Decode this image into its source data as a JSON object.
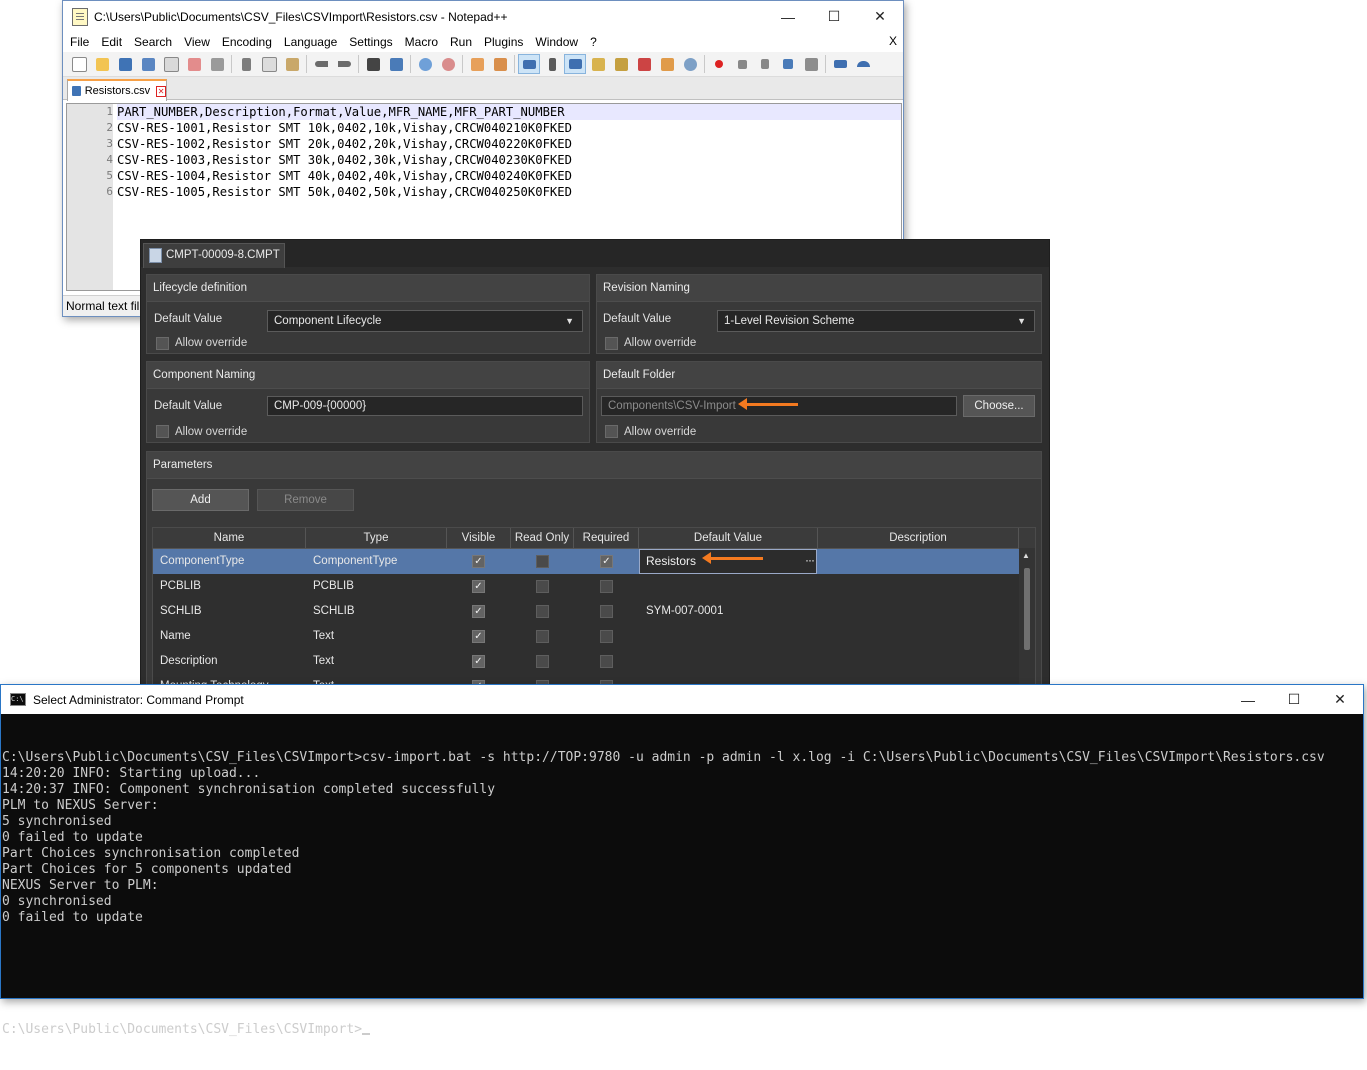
{
  "notepad": {
    "title": "C:\\Users\\Public\\Documents\\CSV_Files\\CSVImport\\Resistors.csv - Notepad++",
    "window_buttons": [
      "—",
      "☐",
      "✕"
    ],
    "menu": [
      "File",
      "Edit",
      "Search",
      "View",
      "Encoding",
      "Language",
      "Settings",
      "Macro",
      "Run",
      "Plugins",
      "Window",
      "?"
    ],
    "menu_close": "X",
    "tab_label": "Resistors.csv",
    "line_numbers": [
      "1",
      "2",
      "3",
      "4",
      "5",
      "6"
    ],
    "lines": [
      "PART_NUMBER,Description,Format,Value,MFR_NAME,MFR_PART_NUMBER",
      "CSV-RES-1001,Resistor SMT 10k,0402,10k,Vishay,CRCW040210K0FKED",
      "CSV-RES-1002,Resistor SMT 20k,0402,20k,Vishay,CRCW040220K0FKED",
      "CSV-RES-1003,Resistor SMT 30k,0402,30k,Vishay,CRCW040230K0FKED",
      "CSV-RES-1004,Resistor SMT 40k,0402,40k,Vishay,CRCW040240K0FKED",
      "CSV-RES-1005,Resistor SMT 50k,0402,50k,Vishay,CRCW040250K0FKED"
    ],
    "status": "Normal text fil"
  },
  "cmpt": {
    "tab_label": "CMPT-00009-8.CMPT",
    "lifecycle": {
      "heading": "Lifecycle definition",
      "default_label": "Default Value",
      "value": "Component Lifecycle",
      "allow_override": "Allow override"
    },
    "revision": {
      "heading": "Revision Naming",
      "default_label": "Default Value",
      "value": "1-Level Revision Scheme",
      "allow_override": "Allow override"
    },
    "naming": {
      "heading": "Component Naming",
      "default_label": "Default Value",
      "value": "CMP-009-{00000}",
      "allow_override": "Allow override"
    },
    "folder": {
      "heading": "Default Folder",
      "value": "Components\\CSV-Import",
      "choose_button": "Choose...",
      "allow_override": "Allow override"
    },
    "parameters": {
      "heading": "Parameters",
      "add_button": "Add",
      "remove_button": "Remove",
      "columns": [
        "Name",
        "Type",
        "Visible",
        "Read Only",
        "Required",
        "Default Value",
        "Description"
      ],
      "rows": [
        {
          "name": "ComponentType",
          "type": "ComponentType",
          "visible": true,
          "read_only": false,
          "required": true,
          "default": "Resistors",
          "description": ""
        },
        {
          "name": "PCBLIB",
          "type": "PCBLIB",
          "visible": true,
          "read_only": false,
          "required": false,
          "default": "",
          "description": ""
        },
        {
          "name": "SCHLIB",
          "type": "SCHLIB",
          "visible": true,
          "read_only": false,
          "required": false,
          "default": "SYM-007-0001",
          "description": ""
        },
        {
          "name": "Name",
          "type": "Text",
          "visible": true,
          "read_only": false,
          "required": false,
          "default": "",
          "description": ""
        },
        {
          "name": "Description",
          "type": "Text",
          "visible": true,
          "read_only": false,
          "required": false,
          "default": "",
          "description": ""
        },
        {
          "name": "Mounting Technology",
          "type": "Text",
          "visible": true,
          "read_only": false,
          "required": false,
          "default": "",
          "description": ""
        }
      ],
      "edit_dots": "···"
    }
  },
  "cmd": {
    "title": "Select Administrator: Command Prompt",
    "icon_text": "C:\\",
    "window_buttons": [
      "—",
      "☐",
      "✕"
    ],
    "output": [
      "C:\\Users\\Public\\Documents\\CSV_Files\\CSVImport>csv-import.bat -s http://TOP:9780 -u admin -p admin -l x.log -i C:\\Users\\Public\\Documents\\CSV_Files\\CSVImport\\Resistors.csv",
      "14:20:20 INFO: Starting upload...",
      "14:20:37 INFO: Component synchronisation completed successfully",
      "PLM to NEXUS Server:",
      "5 synchronised",
      "0 failed to update",
      "Part Choices synchronisation completed",
      "Part Choices for 5 components updated",
      "NEXUS Server to PLM:",
      "0 synchronised",
      "0 failed to update"
    ],
    "prompt": "C:\\Users\\Public\\Documents\\CSV_Files\\CSVImport>"
  },
  "colors": {
    "accent_arrow": "#f47a20",
    "selected_row": "#5577a8",
    "dark_panel": "#2d2d2d",
    "console_bg": "#0c0c0c"
  }
}
